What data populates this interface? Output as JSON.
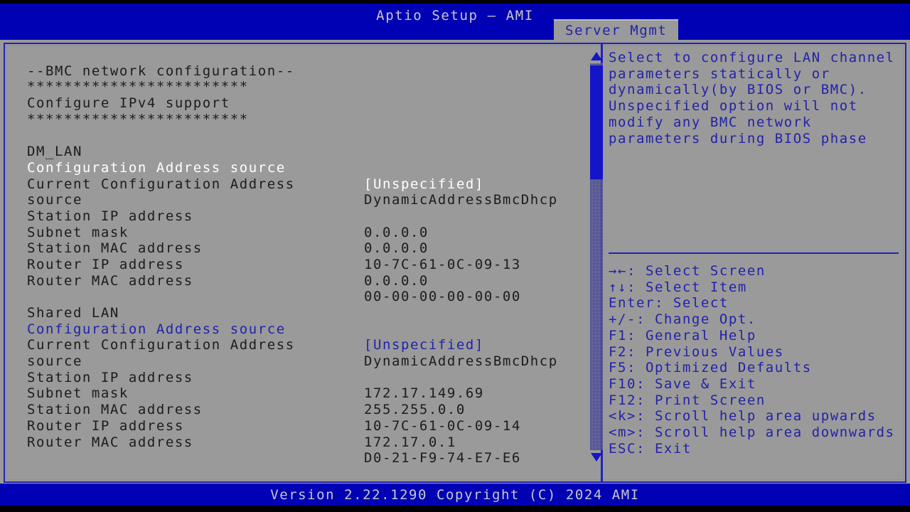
{
  "window": {
    "title": "Aptio Setup – AMI"
  },
  "tabs": [
    {
      "label": "Server Mgmt",
      "active": true
    }
  ],
  "main": {
    "section_header": "--BMC network configuration--",
    "separator": "************************",
    "subheader": "Configure IPv4 support",
    "groups": [
      {
        "name": "DM_LAN",
        "rows": [
          {
            "label": "Configuration Address source",
            "value": "[Unspecified]",
            "style": "selected"
          },
          {
            "label": "Current Configuration Address",
            "value": "DynamicAddressBmcDhcp",
            "style": "normal"
          },
          {
            "label": "source",
            "value": "",
            "style": "normal"
          },
          {
            "label": "Station IP address",
            "value": "0.0.0.0",
            "style": "normal"
          },
          {
            "label": "Subnet mask",
            "value": "0.0.0.0",
            "style": "normal"
          },
          {
            "label": "Station MAC address",
            "value": "10-7C-61-0C-09-13",
            "style": "normal"
          },
          {
            "label": "Router IP address",
            "value": "0.0.0.0",
            "style": "normal"
          },
          {
            "label": "Router MAC address",
            "value": "00-00-00-00-00-00",
            "style": "normal"
          }
        ]
      },
      {
        "name": "Shared LAN",
        "rows": [
          {
            "label": "Configuration Address source",
            "value": "[Unspecified]",
            "style": "link"
          },
          {
            "label": "Current Configuration Address",
            "value": "DynamicAddressBmcDhcp",
            "style": "normal"
          },
          {
            "label": "source",
            "value": "",
            "style": "normal"
          },
          {
            "label": "Station IP address",
            "value": "172.17.149.69",
            "style": "normal"
          },
          {
            "label": "Subnet mask",
            "value": "255.255.0.0",
            "style": "normal"
          },
          {
            "label": "Station MAC address",
            "value": "10-7C-61-0C-09-14",
            "style": "normal"
          },
          {
            "label": "Router IP address",
            "value": "172.17.0.1",
            "style": "normal"
          },
          {
            "label": "Router MAC address",
            "value": "D0-21-F9-74-E7-E6",
            "style": "normal"
          }
        ]
      }
    ]
  },
  "scrollbar": {
    "up_arrow_icon": "triangle-up-icon",
    "down_arrow_icon": "triangle-down-icon",
    "thumb_position_percent": 0,
    "thumb_size_percent": 30
  },
  "help": {
    "text": "Select to configure LAN channel parameters statically or dynamically(by BIOS or BMC). Unspecified option will not modify any BMC network parameters during BIOS phase",
    "keys": [
      "→←: Select Screen",
      "↑↓: Select Item",
      "Enter: Select",
      "+/-: Change Opt.",
      "F1: General Help",
      "F2: Previous Values",
      "F5: Optimized Defaults",
      "F10: Save & Exit",
      "F12: Print Screen",
      "<k>: Scroll help area upwards",
      "<m>: Scroll help area downwards",
      "ESC: Exit"
    ]
  },
  "footer": {
    "version_text": "Version 2.22.1290 Copyright (C) 2024 AMI"
  },
  "colors": {
    "title_bar": "#0000b4",
    "body": "#9a9a9a",
    "accent_blue": "#2222aa",
    "border_blue": "#2222bb",
    "selected_text": "#ffffff",
    "label_text": "#1c1c1c"
  }
}
